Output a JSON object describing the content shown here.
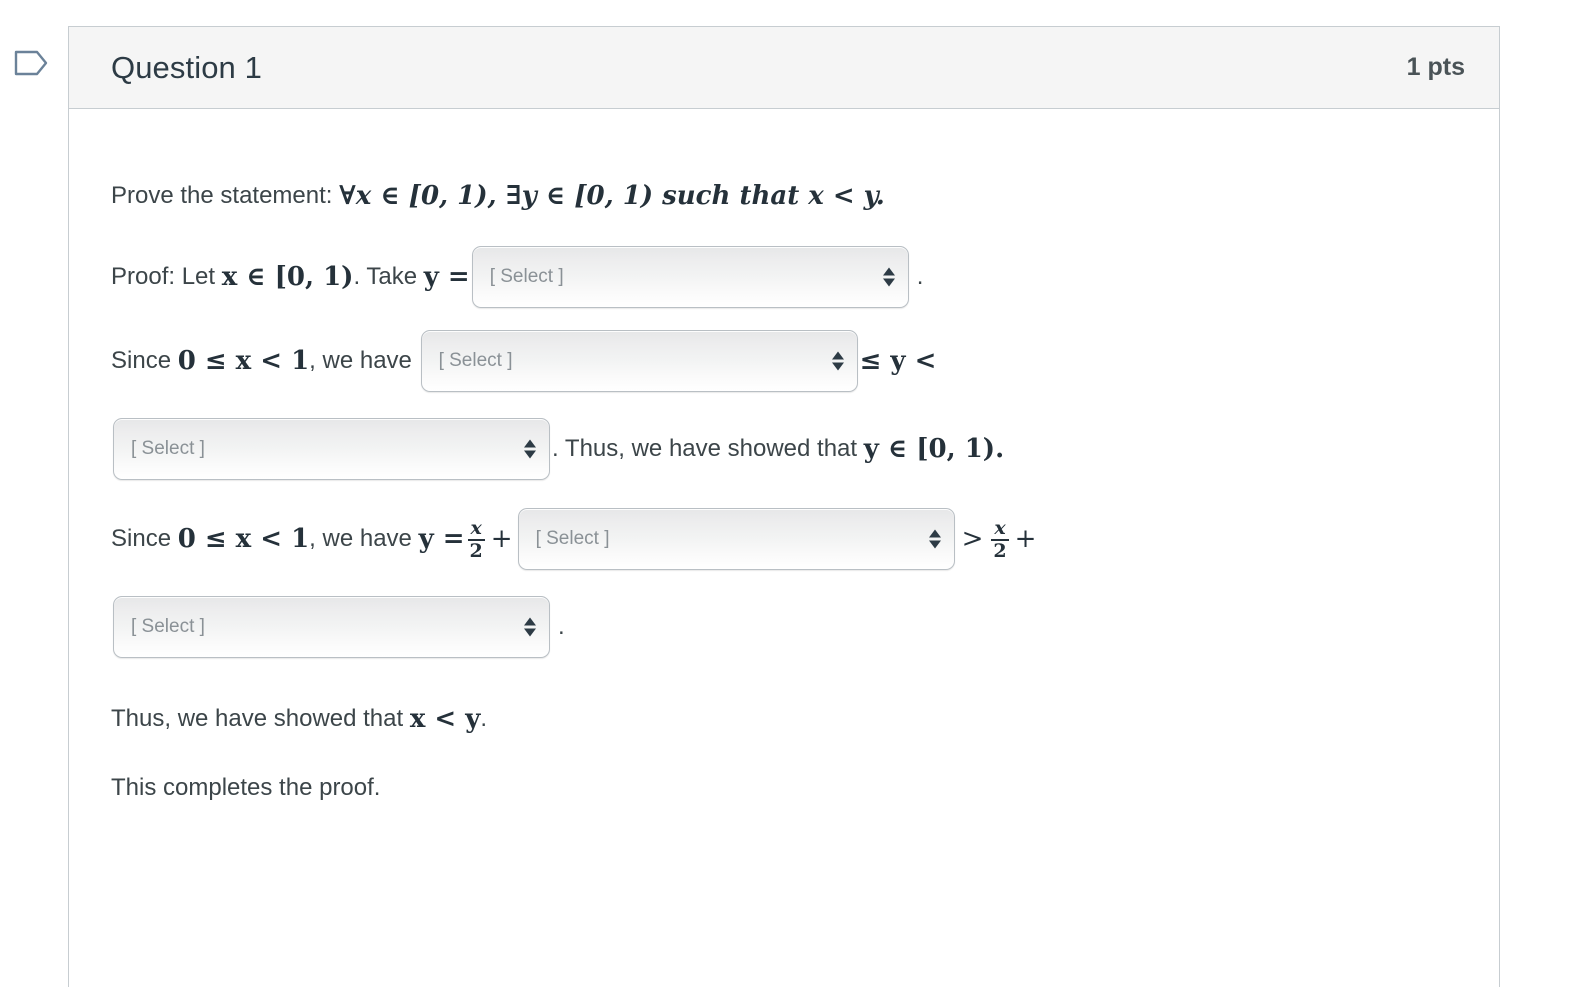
{
  "gutter": {
    "flag_icon": "flag-outline-icon"
  },
  "header": {
    "title": "Question 1",
    "points": "1 pts"
  },
  "select_placeholder": "[ Select ]",
  "proof": {
    "statement": {
      "lead": "Prove the statement: ",
      "math": "∀x ∈ [0, 1), ∃y ∈ [0, 1) such that x < y."
    },
    "line_take": {
      "lead": "Proof: Let ",
      "math_x": "x ∈ [0, 1)",
      "mid": ". Take ",
      "math_y": "y =",
      "trailing": "."
    },
    "line_since1": {
      "lead": "Since ",
      "math_cond": "0 ≤ x < 1",
      "mid": ", we have ",
      "math_tail": "≤ y <"
    },
    "line_thus_y": {
      "text": ". Thus, we have showed that ",
      "math": "y ∈ [0, 1)."
    },
    "line_since2": {
      "lead": "Since ",
      "math_cond": "0 ≤ x < 1",
      "mid": ", we have ",
      "math_y_eq": "y =",
      "frac_num": "x",
      "frac_den": "2",
      "plus": "+",
      "gt": ">",
      "frac2_num": "x",
      "frac2_den": "2",
      "plus2": "+"
    },
    "line_last_select": {
      "trailing": "."
    },
    "line_thus_x": {
      "text": "Thus, we have showed that ",
      "math": "x < y",
      "period": "."
    },
    "line_complete": {
      "text": "This completes the proof."
    }
  },
  "colors": {
    "header_bg": "#f5f5f5",
    "border": "#c7cdd1",
    "title_text": "#2d3b45",
    "body_text": "#3c4549",
    "math_text": "#25313a",
    "placeholder_text": "#8a9196",
    "flag_stroke": "#6b8299"
  }
}
